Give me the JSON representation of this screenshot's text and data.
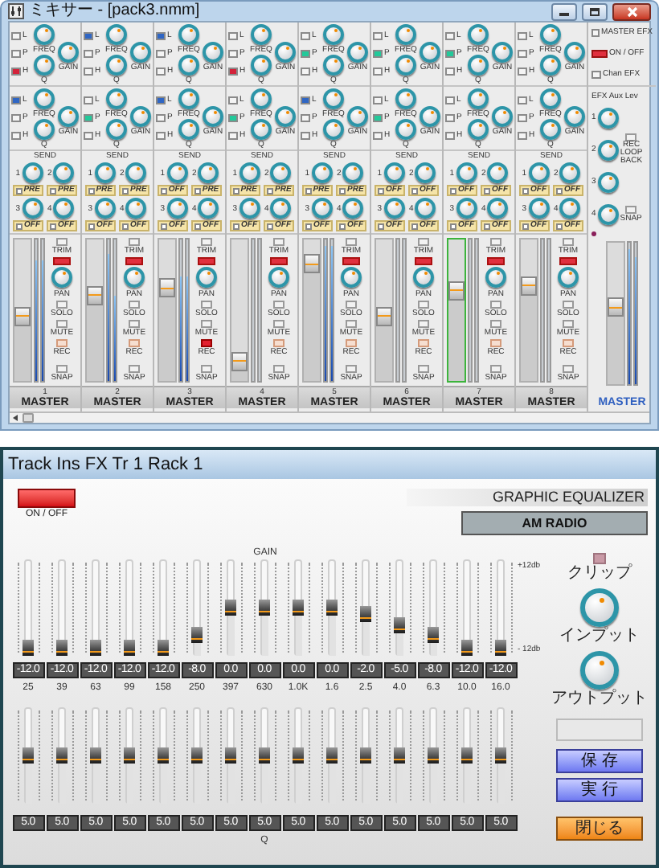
{
  "mixer": {
    "title": "ミキサー - [pack3.nmm]",
    "channels": [
      {
        "number": "1",
        "bus": "MASTER",
        "selected": false,
        "eq": [
          {
            "bands": [
              {
                "label": "L",
                "on": false
              },
              {
                "label": "P",
                "on": false
              },
              {
                "label": "H",
                "on": true
              }
            ],
            "freq": "FREQ",
            "gain": "GAIN",
            "q": "Q"
          },
          {
            "bands": [
              {
                "label": "L",
                "on": true
              },
              {
                "label": "P",
                "on": false
              },
              {
                "label": "H",
                "on": false
              }
            ],
            "freq": "FREQ",
            "gain": "GAIN",
            "q": "Q"
          }
        ],
        "send_title": "SEND",
        "sends": [
          {
            "number": "1",
            "mode": "PRE"
          },
          {
            "number": "2",
            "mode": "PRE"
          },
          {
            "number": "3",
            "mode": "OFF"
          },
          {
            "number": "4",
            "mode": "OFF"
          }
        ],
        "fader": {
          "level": 0.45
        },
        "meters": [
          {
            "level": 0.85
          },
          {
            "level": 0.85
          }
        ],
        "trim": "TRIM",
        "pan": "PAN",
        "solo": "SOLO",
        "mute": "MUTE",
        "rec": "REC",
        "rec_on": false,
        "snap": "SNAP"
      },
      {
        "number": "2",
        "bus": "MASTER",
        "selected": false,
        "eq": [
          {
            "bands": [
              {
                "label": "L",
                "on": true
              },
              {
                "label": "P",
                "on": false
              },
              {
                "label": "H",
                "on": false
              }
            ],
            "freq": "FREQ",
            "gain": "GAIN",
            "q": "Q"
          },
          {
            "bands": [
              {
                "label": "L",
                "on": false
              },
              {
                "label": "P",
                "on": true
              },
              {
                "label": "H",
                "on": false
              }
            ],
            "freq": "FREQ",
            "gain": "GAIN",
            "q": "Q"
          }
        ],
        "send_title": "SEND",
        "sends": [
          {
            "number": "1",
            "mode": "PRE"
          },
          {
            "number": "2",
            "mode": "PRE"
          },
          {
            "number": "3",
            "mode": "OFF"
          },
          {
            "number": "4",
            "mode": "OFF"
          }
        ],
        "fader": {
          "level": 0.62
        },
        "meters": [
          {
            "level": 0.9
          },
          {
            "level": 0.6
          }
        ],
        "trim": "TRIM",
        "pan": "PAN",
        "solo": "SOLO",
        "mute": "MUTE",
        "rec": "REC",
        "rec_on": false,
        "snap": "SNAP"
      },
      {
        "number": "3",
        "bus": "MASTER",
        "selected": false,
        "eq": [
          {
            "bands": [
              {
                "label": "L",
                "on": true
              },
              {
                "label": "P",
                "on": false
              },
              {
                "label": "H",
                "on": false
              }
            ],
            "freq": "FREQ",
            "gain": "GAIN",
            "q": "Q"
          },
          {
            "bands": [
              {
                "label": "L",
                "on": true
              },
              {
                "label": "P",
                "on": false
              },
              {
                "label": "H",
                "on": false
              }
            ],
            "freq": "FREQ",
            "gain": "GAIN",
            "q": "Q"
          }
        ],
        "send_title": "SEND",
        "sends": [
          {
            "number": "1",
            "mode": "OFF"
          },
          {
            "number": "2",
            "mode": "PRE"
          },
          {
            "number": "3",
            "mode": "OFF"
          },
          {
            "number": "4",
            "mode": "OFF"
          }
        ],
        "fader": {
          "level": 0.68
        },
        "meters": [
          {
            "level": 0.74
          },
          {
            "level": 0.74
          }
        ],
        "trim": "TRIM",
        "pan": "PAN",
        "solo": "SOLO",
        "mute": "MUTE",
        "rec": "REC",
        "rec_on": true,
        "snap": "SNAP"
      },
      {
        "number": "4",
        "bus": "MASTER",
        "selected": false,
        "eq": [
          {
            "bands": [
              {
                "label": "L",
                "on": false
              },
              {
                "label": "P",
                "on": false
              },
              {
                "label": "H",
                "on": true
              }
            ],
            "freq": "FREQ",
            "gain": "GAIN",
            "q": "Q"
          },
          {
            "bands": [
              {
                "label": "L",
                "on": false
              },
              {
                "label": "P",
                "on": true
              },
              {
                "label": "H",
                "on": false
              }
            ],
            "freq": "FREQ",
            "gain": "GAIN",
            "q": "Q"
          }
        ],
        "send_title": "SEND",
        "sends": [
          {
            "number": "1",
            "mode": "PRE"
          },
          {
            "number": "2",
            "mode": "PRE"
          },
          {
            "number": "3",
            "mode": "OFF"
          },
          {
            "number": "4",
            "mode": "OFF"
          }
        ],
        "fader": {
          "level": 0.08
        },
        "meters": [
          {
            "level": 0
          },
          {
            "level": 0
          }
        ],
        "trim": "TRIM",
        "pan": "PAN",
        "solo": "SOLO",
        "mute": "MUTE",
        "rec": "REC",
        "rec_on": false,
        "snap": "SNAP"
      },
      {
        "number": "5",
        "bus": "MASTER",
        "selected": false,
        "eq": [
          {
            "bands": [
              {
                "label": "L",
                "on": false
              },
              {
                "label": "P",
                "on": true
              },
              {
                "label": "H",
                "on": false
              }
            ],
            "freq": "FREQ",
            "gain": "GAIN",
            "q": "Q"
          },
          {
            "bands": [
              {
                "label": "L",
                "on": true
              },
              {
                "label": "P",
                "on": false
              },
              {
                "label": "H",
                "on": false
              }
            ],
            "freq": "FREQ",
            "gain": "GAIN",
            "q": "Q"
          }
        ],
        "send_title": "SEND",
        "sends": [
          {
            "number": "1",
            "mode": "PRE"
          },
          {
            "number": "2",
            "mode": "PRE"
          },
          {
            "number": "3",
            "mode": "OFF"
          },
          {
            "number": "4",
            "mode": "OFF"
          }
        ],
        "fader": {
          "level": 0.88
        },
        "meters": [
          {
            "level": 0.95
          },
          {
            "level": 0.95
          }
        ],
        "trim": "TRIM",
        "pan": "PAN",
        "solo": "SOLO",
        "mute": "MUTE",
        "rec": "REC",
        "rec_on": false,
        "snap": "SNAP"
      },
      {
        "number": "6",
        "bus": "MASTER",
        "selected": false,
        "eq": [
          {
            "bands": [
              {
                "label": "L",
                "on": false
              },
              {
                "label": "P",
                "on": true
              },
              {
                "label": "H",
                "on": false
              }
            ],
            "freq": "FREQ",
            "gain": "GAIN",
            "q": "Q"
          },
          {
            "bands": [
              {
                "label": "L",
                "on": false
              },
              {
                "label": "P",
                "on": true
              },
              {
                "label": "H",
                "on": false
              }
            ],
            "freq": "FREQ",
            "gain": "GAIN",
            "q": "Q"
          }
        ],
        "send_title": "SEND",
        "sends": [
          {
            "number": "1",
            "mode": "OFF"
          },
          {
            "number": "2",
            "mode": "OFF"
          },
          {
            "number": "3",
            "mode": "OFF"
          },
          {
            "number": "4",
            "mode": "OFF"
          }
        ],
        "fader": {
          "level": 0.45
        },
        "meters": [
          {
            "level": 0
          },
          {
            "level": 0
          }
        ],
        "trim": "TRIM",
        "pan": "PAN",
        "solo": "SOLO",
        "mute": "MUTE",
        "rec": "REC",
        "rec_on": false,
        "snap": "SNAP"
      },
      {
        "number": "7",
        "bus": "MASTER",
        "selected": true,
        "eq": [
          {
            "bands": [
              {
                "label": "L",
                "on": false
              },
              {
                "label": "P",
                "on": true
              },
              {
                "label": "H",
                "on": false
              }
            ],
            "freq": "FREQ",
            "gain": "GAIN",
            "q": "Q"
          },
          {
            "bands": [
              {
                "label": "L",
                "on": false
              },
              {
                "label": "P",
                "on": false
              },
              {
                "label": "H",
                "on": false
              }
            ],
            "freq": "FREQ",
            "gain": "GAIN",
            "q": "Q"
          }
        ],
        "send_title": "SEND",
        "sends": [
          {
            "number": "1",
            "mode": "OFF"
          },
          {
            "number": "2",
            "mode": "OFF"
          },
          {
            "number": "3",
            "mode": "OFF"
          },
          {
            "number": "4",
            "mode": "OFF"
          }
        ],
        "fader": {
          "level": 0.66
        },
        "meters": [
          {
            "level": 0
          },
          {
            "level": 0
          }
        ],
        "trim": "TRIM",
        "pan": "PAN",
        "solo": "SOLO",
        "mute": "MUTE",
        "rec": "REC",
        "rec_on": false,
        "snap": "SNAP"
      },
      {
        "number": "8",
        "bus": "MASTER",
        "selected": false,
        "eq": [
          {
            "bands": [
              {
                "label": "L",
                "on": false
              },
              {
                "label": "P",
                "on": false
              },
              {
                "label": "H",
                "on": false
              }
            ],
            "freq": "FREQ",
            "gain": "GAIN",
            "q": "Q"
          },
          {
            "bands": [
              {
                "label": "L",
                "on": false
              },
              {
                "label": "P",
                "on": false
              },
              {
                "label": "H",
                "on": false
              }
            ],
            "freq": "FREQ",
            "gain": "GAIN",
            "q": "Q"
          }
        ],
        "send_title": "SEND",
        "sends": [
          {
            "number": "1",
            "mode": "OFF"
          },
          {
            "number": "2",
            "mode": "OFF"
          },
          {
            "number": "3",
            "mode": "OFF"
          },
          {
            "number": "4",
            "mode": "OFF"
          }
        ],
        "fader": {
          "level": 0.7
        },
        "meters": [
          {
            "level": 0
          },
          {
            "level": 0
          }
        ],
        "trim": "TRIM",
        "pan": "PAN",
        "solo": "SOLO",
        "mute": "MUTE",
        "rec": "REC",
        "rec_on": false,
        "snap": "SNAP"
      }
    ],
    "master": {
      "master_efx": {
        "label": "MASTER EFX",
        "checked": false
      },
      "power": {
        "label": "ON / OFF",
        "on": true
      },
      "chan_efx": {
        "label": "Chan EFX",
        "checked": false
      },
      "aux_title": "EFX Aux Lev",
      "aux": [
        "1",
        "2",
        "3",
        "4"
      ],
      "loopback": "REC LOOP BACK",
      "snap": "SNAP",
      "fader": {
        "level": 0.55
      },
      "meters": [
        {
          "level": 0.95
        },
        {
          "level": 0.9
        }
      ],
      "label": "MASTER"
    }
  },
  "equalizer": {
    "title": "Track Ins FX Tr 1 Rack 1",
    "power": {
      "label": "ON / OFF",
      "on": true
    },
    "name": "GRAPHIC EQUALIZER",
    "preset": "AM RADIO",
    "gain_title": "GAIN",
    "scale_top": "+12db",
    "scale_bottom": "- 12db",
    "bands": [
      {
        "gain": {
          "level": 0
        },
        "value": "-12.0",
        "freq": "25",
        "q": {
          "level": 0.5
        },
        "q_value": "5.0"
      },
      {
        "gain": {
          "level": 0
        },
        "value": "-12.0",
        "freq": "39",
        "q": {
          "level": 0.5
        },
        "q_value": "5.0"
      },
      {
        "gain": {
          "level": 0
        },
        "value": "-12.0",
        "freq": "63",
        "q": {
          "level": 0.5
        },
        "q_value": "5.0"
      },
      {
        "gain": {
          "level": 0
        },
        "value": "-12.0",
        "freq": "99",
        "q": {
          "level": 0.5
        },
        "q_value": "5.0"
      },
      {
        "gain": {
          "level": 0
        },
        "value": "-12.0",
        "freq": "158",
        "q": {
          "level": 0.5
        },
        "q_value": "5.0"
      },
      {
        "gain": {
          "level": 0.17
        },
        "value": "-8.0",
        "freq": "250",
        "q": {
          "level": 0.5
        },
        "q_value": "5.0"
      },
      {
        "gain": {
          "level": 0.5
        },
        "value": "0.0",
        "freq": "397",
        "q": {
          "level": 0.5
        },
        "q_value": "5.0"
      },
      {
        "gain": {
          "level": 0.5
        },
        "value": "0.0",
        "freq": "630",
        "q": {
          "level": 0.5
        },
        "q_value": "5.0"
      },
      {
        "gain": {
          "level": 0.5
        },
        "value": "0.0",
        "freq": "1.0K",
        "q": {
          "level": 0.5
        },
        "q_value": "5.0"
      },
      {
        "gain": {
          "level": 0.5
        },
        "value": "0.0",
        "freq": "1.6",
        "q": {
          "level": 0.5
        },
        "q_value": "5.0"
      },
      {
        "gain": {
          "level": 0.42
        },
        "value": "-2.0",
        "freq": "2.5",
        "q": {
          "level": 0.5
        },
        "q_value": "5.0"
      },
      {
        "gain": {
          "level": 0.29
        },
        "value": "-5.0",
        "freq": "4.0",
        "q": {
          "level": 0.5
        },
        "q_value": "5.0"
      },
      {
        "gain": {
          "level": 0.17
        },
        "value": "-8.0",
        "freq": "6.3",
        "q": {
          "level": 0.5
        },
        "q_value": "5.0"
      },
      {
        "gain": {
          "level": 0
        },
        "value": "-12.0",
        "freq": "10.0",
        "q": {
          "level": 0.5
        },
        "q_value": "5.0"
      },
      {
        "gain": {
          "level": 0
        },
        "value": "-12.0",
        "freq": "16.0",
        "q": {
          "level": 0.5
        },
        "q_value": "5.0"
      }
    ],
    "q_title": "Q",
    "clip": {
      "label": "クリップ",
      "on": false
    },
    "input": "インプット",
    "output": "アウトプット",
    "buttons": [
      {
        "label": "保 存",
        "kind": "action"
      },
      {
        "label": "実 行",
        "kind": "action"
      },
      {
        "label": "閉じる",
        "kind": "close"
      }
    ]
  }
}
